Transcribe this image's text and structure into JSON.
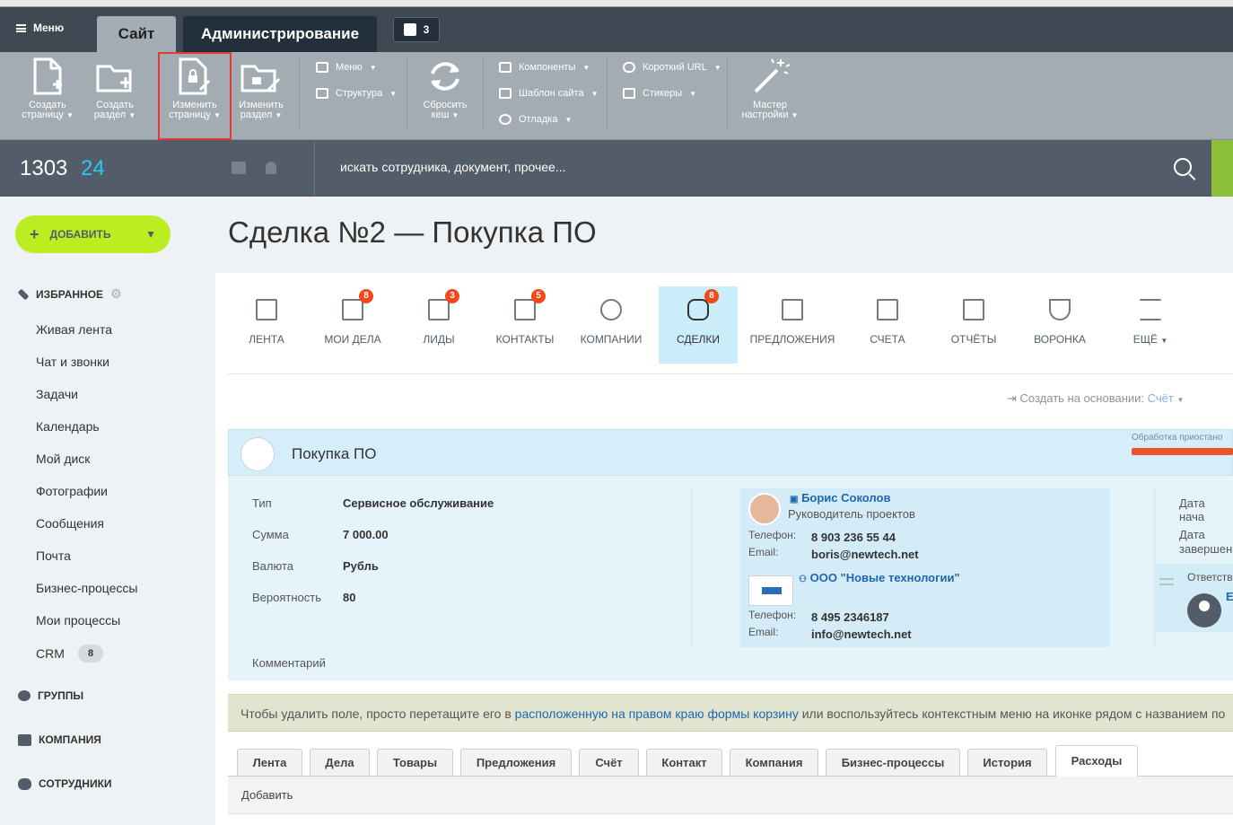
{
  "admin": {
    "menu_label": "Меню",
    "tab_site": "Сайт",
    "tab_admin": "Администрирование",
    "notifications_count": "3",
    "toolbar": {
      "create_page": [
        "Создать",
        "страницу"
      ],
      "create_section": [
        "Создать",
        "раздел"
      ],
      "edit_page": [
        "Изменить",
        "страницу"
      ],
      "edit_section": [
        "Изменить",
        "раздел"
      ],
      "menu": "Меню",
      "structure": "Структура",
      "reset_cache": [
        "Сбросить",
        "кеш"
      ],
      "components": "Компоненты",
      "site_template": "Шаблон сайта",
      "debug": "Отладка",
      "short_url": "Короткий URL",
      "stickers": "Стикеры",
      "wizard": [
        "Мастер",
        "настройки"
      ]
    }
  },
  "header": {
    "clock_hours": "1303",
    "clock_minutes": "24",
    "search_placeholder": "искать сотрудника, документ, прочее..."
  },
  "sidebar": {
    "add_button": "ДОБАВИТЬ",
    "favorites": "ИЗБРАННОЕ",
    "items": [
      "Живая лента",
      "Чат и звонки",
      "Задачи",
      "Календарь",
      "Мой диск",
      "Фотографии",
      "Сообщения",
      "Почта",
      "Бизнес-процессы",
      "Мои процессы",
      "CRM"
    ],
    "crm_badge": "8",
    "groups": "ГРУППЫ",
    "company": "КОМПАНИЯ",
    "employees": "СОТРУДНИКИ"
  },
  "page": {
    "title": "Сделка №2 — Покупка ПО"
  },
  "crm_tabs": [
    {
      "label": "ЛЕНТА",
      "badge": ""
    },
    {
      "label": "МОИ ДЕЛА",
      "badge": "8"
    },
    {
      "label": "ЛИДЫ",
      "badge": "3"
    },
    {
      "label": "КОНТАКТЫ",
      "badge": "5"
    },
    {
      "label": "КОМПАНИИ",
      "badge": ""
    },
    {
      "label": "СДЕЛКИ",
      "badge": "8"
    },
    {
      "label": "ПРЕДЛОЖЕНИЯ",
      "badge": ""
    },
    {
      "label": "СЧЕТА",
      "badge": ""
    },
    {
      "label": "ОТЧЁТЫ",
      "badge": ""
    },
    {
      "label": "ВОРОНКА",
      "badge": ""
    },
    {
      "label": "ЕЩЁ",
      "badge": ""
    }
  ],
  "create_basis": {
    "label": "Создать на основании:",
    "value": "Счёт"
  },
  "deal": {
    "name": "Покупка ПО",
    "progress_label": "Обработка приостано",
    "fields": {
      "type_label": "Тип",
      "type_value": "Сервисное обслуживание",
      "sum_label": "Сумма",
      "sum_value": "7 000.00",
      "currency_label": "Валюта",
      "currency_value": "Рубль",
      "probability_label": "Вероятность",
      "probability_value": "80",
      "comment_label": "Комментарий"
    },
    "contact": {
      "name": "Борис Соколов",
      "position": "Руководитель проектов",
      "phone_label": "Телефон:",
      "phone": "8 903 236 55 44",
      "email_label": "Email:",
      "email": "boris@newtech.net"
    },
    "company": {
      "name": "ООО \"Новые технологии\"",
      "phone_label": "Телефон:",
      "phone": "8 495 2346187",
      "email_label": "Email:",
      "email": "info@newtech.net"
    },
    "right": {
      "start_date_label": "Дата нача",
      "end_date_label_1": "Дата",
      "end_date_label_2": "завершени",
      "responsible_label": "Ответстве",
      "responsible_initial": "Е"
    }
  },
  "notice": {
    "prefix": "Чтобы удалить поле, просто перетащите его в ",
    "link": "расположенную на правом краю формы корзину",
    "suffix": " или воспользуйтесь контекстным меню на иконке рядом с названием по"
  },
  "bottom_tabs": [
    "Лента",
    "Дела",
    "Товары",
    "Предложения",
    "Счёт",
    "Контакт",
    "Компания",
    "Бизнес-процессы",
    "История",
    "Расходы"
  ],
  "add_row_label": "Добавить",
  "colors": {
    "accent_green": "#bbed21",
    "highlight_red": "#e53935",
    "header_dark": "#535c69",
    "badge_red": "#f54819"
  }
}
